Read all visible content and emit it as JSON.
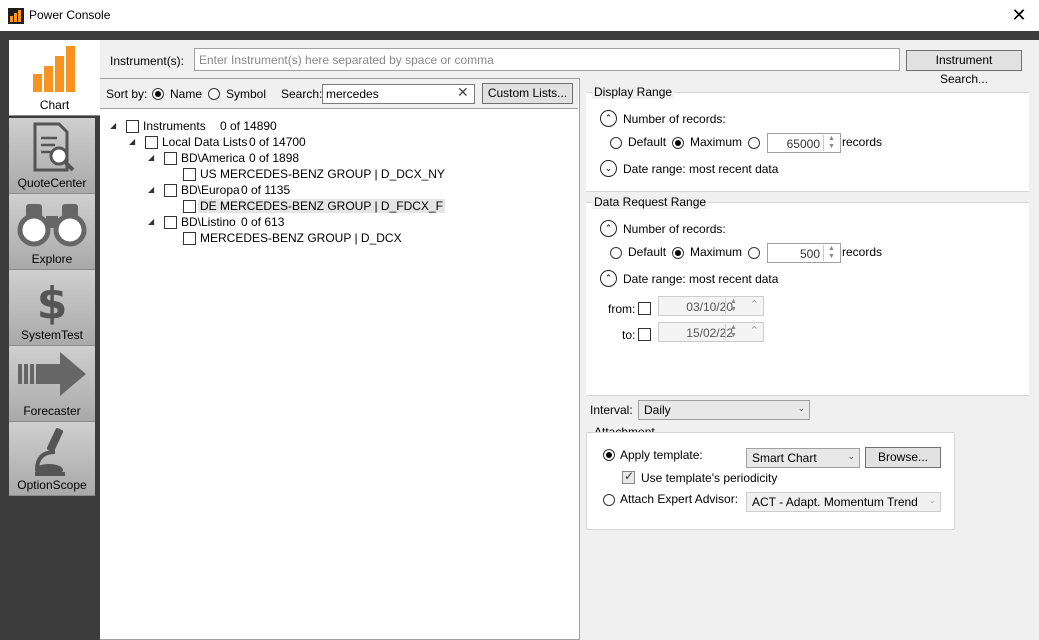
{
  "window": {
    "title": "Power Console",
    "close_glyph": "✕"
  },
  "sidebar": {
    "tabs": [
      {
        "label": "Chart",
        "icon": "bar-chart-icon",
        "active": true
      },
      {
        "label": "QuoteCenter",
        "icon": "document-search-icon"
      },
      {
        "label": "Explore",
        "icon": "binoculars-icon"
      },
      {
        "label": "SystemTest",
        "icon": "dollar-icon"
      },
      {
        "label": "Forecaster",
        "icon": "arrow-right-icon"
      },
      {
        "label": "OptionScope",
        "icon": "microscope-icon"
      }
    ]
  },
  "instruments": {
    "label": "Instrument(s):",
    "placeholder": "Enter Instrument(s) here separated by space or comma",
    "value": "",
    "search_button": "Instrument Search..."
  },
  "sortbar": {
    "sort_label": "Sort by:",
    "name_option": "Name",
    "symbol_option": "Symbol",
    "selected": "Name",
    "search_label": "Search:",
    "search_value": "mercedes",
    "clear_glyph": "✕",
    "custom_lists_button": "Custom Lists..."
  },
  "tree": {
    "expand_glyph": "◢",
    "rows": [
      {
        "label": "Instruments",
        "count": "0 of 14890"
      },
      {
        "label": "Local Data Lists",
        "count": "0 of 14700"
      },
      {
        "label": "BD\\America",
        "count": "0 of 1898"
      },
      {
        "label": "US MERCEDES-BENZ GROUP | D_DCX_NY"
      },
      {
        "label": "BD\\Europa",
        "count": "0 of 1135"
      },
      {
        "label": "DE MERCEDES-BENZ GROUP | D_FDCX_F"
      },
      {
        "label": "BD\\Listino",
        "count": "0 of 613"
      },
      {
        "label": "MERCEDES-BENZ GROUP | D_DCX"
      }
    ]
  },
  "display_range": {
    "title": "Display Range",
    "num_records_label": "Number of records:",
    "default_label": "Default",
    "maximum_label": "Maximum",
    "selected": "Maximum",
    "records_value": "65000",
    "records_label": "records",
    "date_range_label": "Date range: most recent data",
    "collapse_glyph": "⌃",
    "expand_glyph": "⌄"
  },
  "data_request_range": {
    "title": "Data Request Range",
    "num_records_label": "Number of records:",
    "default_label": "Default",
    "maximum_label": "Maximum",
    "selected": "Maximum",
    "records_value": "500",
    "records_label": "records",
    "date_range_label": "Date range: most recent data",
    "from_label": "from:",
    "from_value": "03/10/20",
    "to_label": "to:",
    "to_value": "15/02/22",
    "collapse_glyph": "⌃"
  },
  "interval": {
    "label": "Interval:",
    "value": "Daily",
    "dropdown_glyph": "⌄"
  },
  "attachment": {
    "title": "Attachment",
    "apply_template_label": "Apply template:",
    "template_value": "Smart Chart",
    "browse_button": "Browse...",
    "use_periodicity_label": "Use template's periodicity",
    "use_periodicity_checked": true,
    "attach_ea_label": "Attach Expert Advisor:",
    "ea_value": "ACT - Adapt. Momentum Trend",
    "selected": "Apply template",
    "dropdown_glyph": "⌄"
  },
  "spin_glyphs": {
    "up": "▲",
    "down": "▼"
  },
  "colors": {
    "accent_orange": "#f7931e",
    "sidebar_dark": "#3c3c3c"
  }
}
